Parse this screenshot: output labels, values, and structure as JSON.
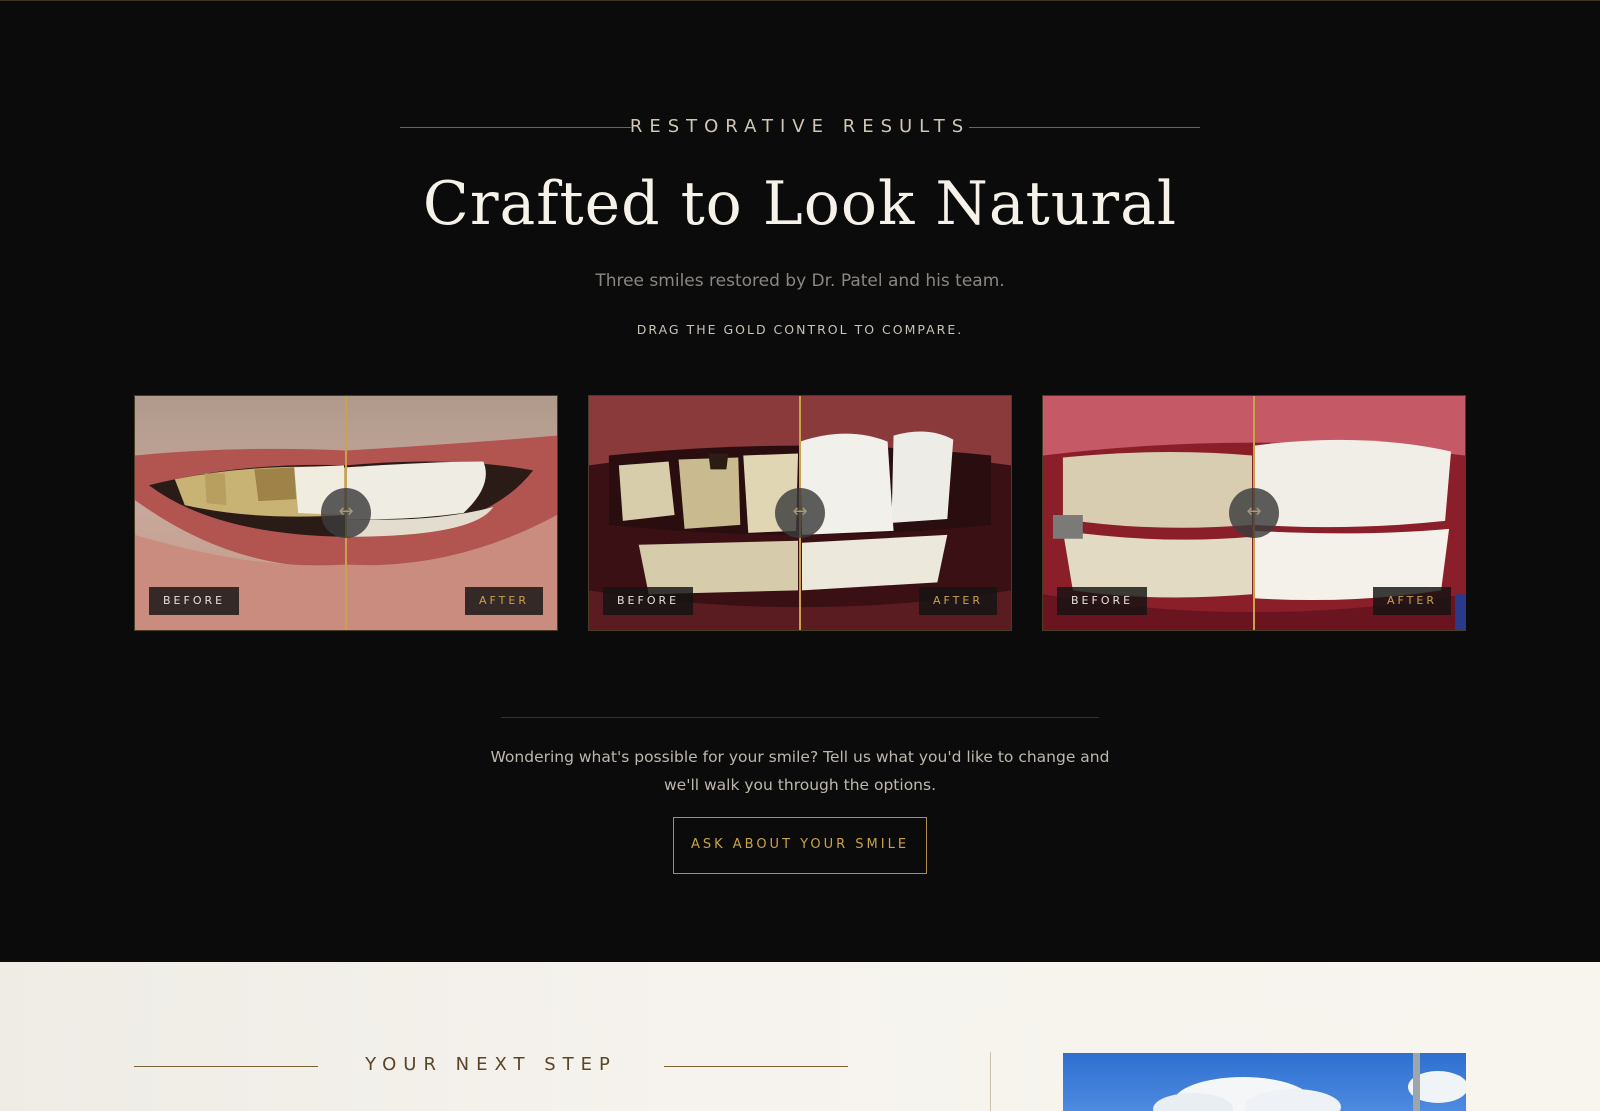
{
  "results": {
    "eyebrow": "RESTORATIVE RESULTS",
    "headline": "Crafted to Look Natural",
    "subtitle": "Three smiles restored by Dr. Patel and his team.",
    "hint": "DRAG THE GOLD CONTROL TO COMPARE.",
    "cases": [
      {
        "before_label": "BEFORE",
        "after_label": "AFTER",
        "handle_icon": "left-right-arrow-icon",
        "split_percent": 50
      },
      {
        "before_label": "BEFORE",
        "after_label": "AFTER",
        "handle_icon": "left-right-arrow-icon",
        "split_percent": 50
      },
      {
        "before_label": "BEFORE",
        "after_label": "AFTER",
        "handle_icon": "left-right-arrow-icon",
        "split_percent": 50
      }
    ],
    "cta_text": "Wondering what's possible for your smile? Tell us what you'd like to change and we'll walk you through the options.",
    "cta_button": "ASK ABOUT YOUR SMILE"
  },
  "next_step": {
    "eyebrow": "YOUR NEXT STEP"
  },
  "colors": {
    "accent_gold": "#c9a24a",
    "dark_bg": "#0b0b0b",
    "light_bg": "#f6f3ee"
  }
}
